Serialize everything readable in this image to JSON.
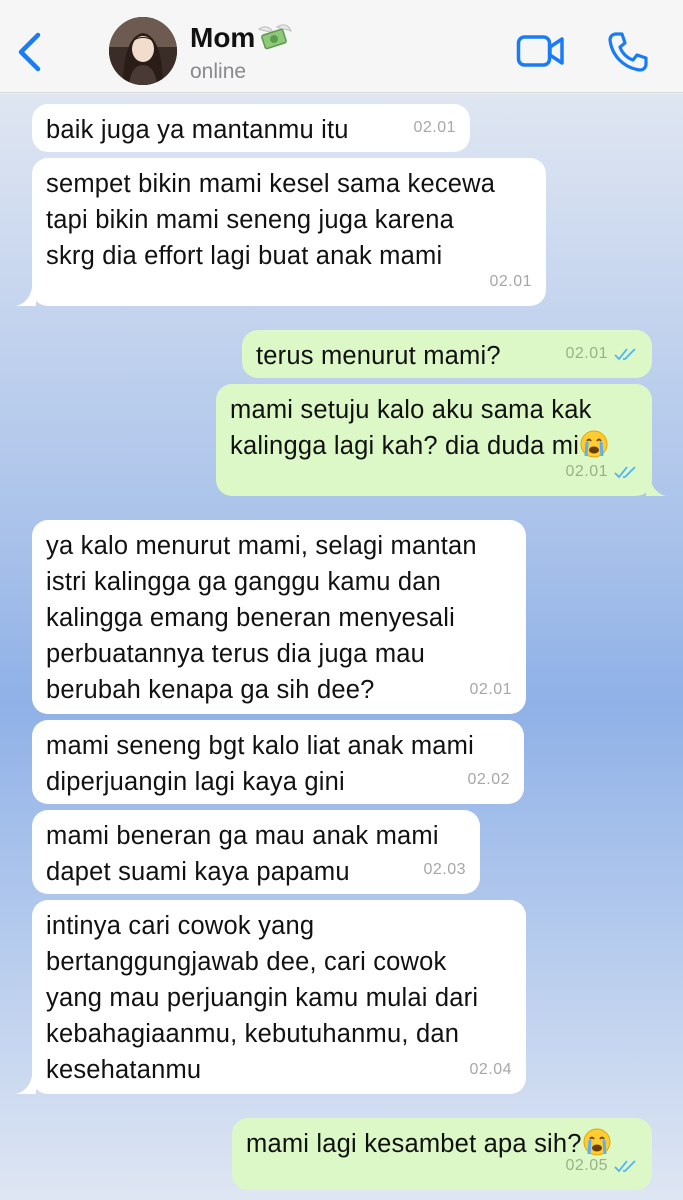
{
  "header": {
    "contact_name": "Mom",
    "name_emoji": "money-with-wings-icon",
    "status": "online",
    "accent_color": "#1a7cf5"
  },
  "messages": [
    {
      "dir": "in",
      "text": "baik juga ya mantanmu itu",
      "time": "02.01"
    },
    {
      "dir": "in",
      "text": "sempet bikin mami kesel sama kecewa\ntapi bikin mami seneng juga karena\nskrg dia effort lagi buat anak mami",
      "time": "02.01"
    },
    {
      "dir": "out",
      "text": "terus menurut mami?",
      "time": "02.01",
      "read": true
    },
    {
      "dir": "out",
      "text": "mami setuju kalo aku sama kak\nkalingga lagi kah? dia duda mi",
      "time": "02.01",
      "read": true,
      "emoji": "crying-face-icon"
    },
    {
      "dir": "in",
      "text": "ya kalo menurut mami, selagi mantan\nistri kalingga ga ganggu kamu dan\nkalingga emang beneran menyesali\nperbuatannya terus dia juga mau\nberubah kenapa ga sih dee?",
      "time": "02.01"
    },
    {
      "dir": "in",
      "text": "mami seneng bgt kalo liat anak mami\ndiperjuangin lagi kaya gini",
      "time": "02.02"
    },
    {
      "dir": "in",
      "text": "mami beneran ga mau anak mami\ndapet suami kaya papamu",
      "time": "02.03"
    },
    {
      "dir": "in",
      "text": "intinya cari cowok yang\nbertanggungjawab dee, cari cowok\nyang mau perjuangin kamu mulai dari\nkebahagiaanmu, kebutuhanmu, dan\nkesehatanmu",
      "time": "02.04"
    },
    {
      "dir": "out",
      "text": "mami lagi kesambet apa sih?",
      "time": "02.05",
      "read": true,
      "emoji": "crying-face-icon"
    }
  ]
}
